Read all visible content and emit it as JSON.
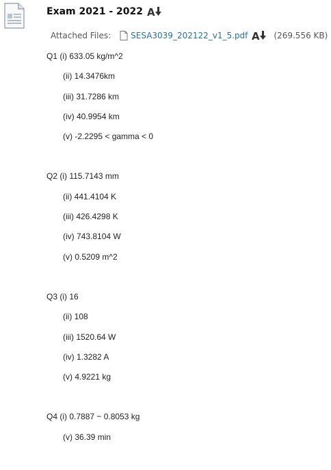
{
  "item": {
    "title": "Exam 2021 - 2022",
    "attached_label": "Attached Files:",
    "file_name": "SESA3039_202122_v1_5.pdf",
    "file_size": "(269.556 KB)"
  },
  "questions": [
    {
      "lines": [
        "Q1 (i) 633.05 kg/m^2",
        "(ii) 14.3476km",
        "(iii) 31.7286 km",
        "(iv) 40.9954 km",
        "(v) -2.2295 < gamma < 0"
      ]
    },
    {
      "lines": [
        "Q2 (i) 115.7143 mm",
        "(ii) 441.4104 K",
        "(iii) 426.4298 K",
        "(iv) 743.8104 W",
        "(v) 0.5209 m^2"
      ]
    },
    {
      "lines": [
        "Q3 (i) 16",
        "(ii) 108",
        "(iii) 1520.64 W",
        "(iv) 1.3282 A",
        "(v) 4.9221 kg"
      ]
    },
    {
      "lines": [
        "Q4 (i) 0.7887 ~ 0.8053 kg",
        "(v) 36.39 min"
      ]
    }
  ],
  "icons": {
    "item_type": "document-icon",
    "translate": "translate-az-icon",
    "file": "file-icon"
  }
}
